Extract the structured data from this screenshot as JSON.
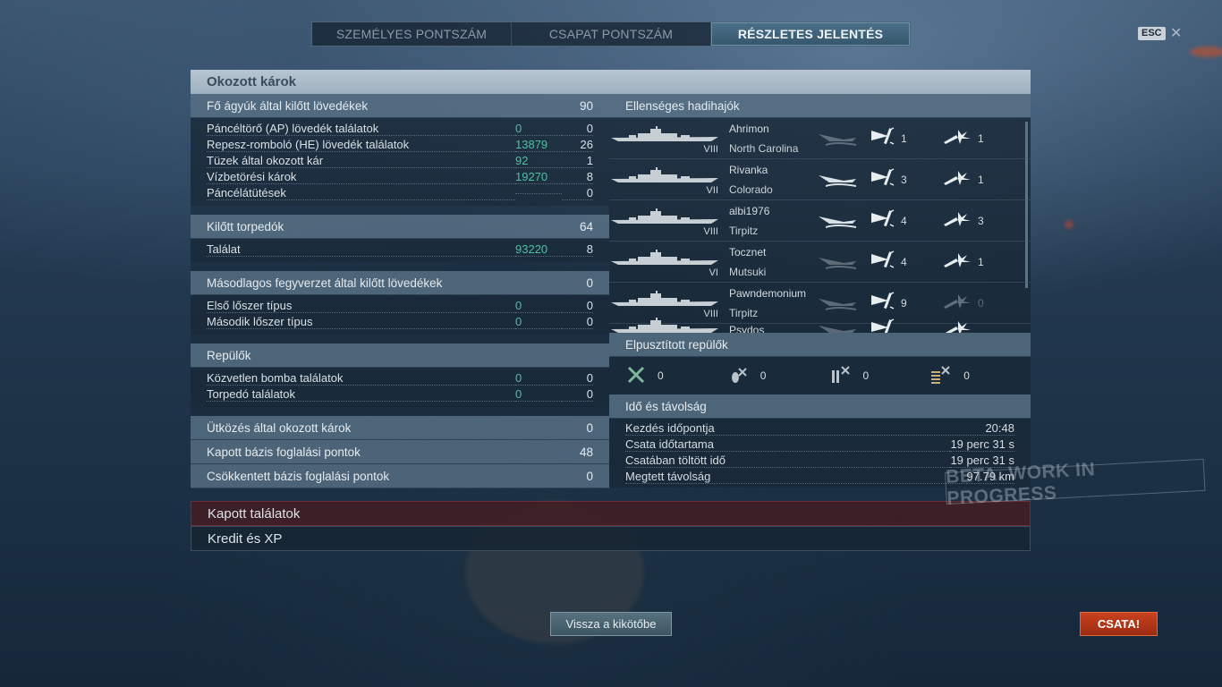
{
  "tabs": [
    {
      "label": "SZEMÉLYES PONTSZÁM"
    },
    {
      "label": "CSAPAT PONTSZÁM"
    },
    {
      "label": "RÉSZLETES JELENTÉS"
    }
  ],
  "esc_label": "ESC",
  "close_symbol": "✕",
  "panel_title": "Okozott károk",
  "main_guns": {
    "header": "Fő ágyúk által kilőtt lövedékek",
    "value": "90",
    "rows": [
      {
        "label": "Páncéltörő (AP) lövedék találatok",
        "dmg": "0",
        "count": "0"
      },
      {
        "label": "Repesz-romboló (HE) lövedék találatok",
        "dmg": "13879",
        "count": "26"
      },
      {
        "label": "Tüzek által okozott kár",
        "dmg": "92",
        "count": "1"
      },
      {
        "label": "Vízbetörési károk",
        "dmg": "19270",
        "count": "8"
      },
      {
        "label": "Páncélátütések",
        "dmg": "",
        "count": "0"
      }
    ]
  },
  "torpedoes": {
    "header": "Kilőtt torpedók",
    "value": "64",
    "rows": [
      {
        "label": "Találat",
        "dmg": "93220",
        "count": "8"
      }
    ]
  },
  "secondary": {
    "header": "Másodlagos fegyverzet által kilőtt lövedékek",
    "value": "0",
    "rows": [
      {
        "label": "Első lőszer típus",
        "dmg": "0",
        "count": "0"
      },
      {
        "label": "Második lőszer típus",
        "dmg": "0",
        "count": "0"
      }
    ]
  },
  "planes_section": {
    "header": "Repülők",
    "value": "",
    "rows": [
      {
        "label": "Közvetlen bomba találatok",
        "dmg": "0",
        "count": "0"
      },
      {
        "label": "Torpedó találatok",
        "dmg": "0",
        "count": "0"
      }
    ]
  },
  "ramming": {
    "label": "Ütközés által okozott károk",
    "value": "0"
  },
  "capture": {
    "label": "Kapott bázis foglalási pontok",
    "value": "48"
  },
  "defense": {
    "label": "Csökkentett bázis foglalási pontok",
    "value": "0"
  },
  "enemy_ships": {
    "header": "Ellenséges hadihajók",
    "ships": [
      {
        "player": "Ahrimon",
        "ship": "North Carolina",
        "tier": "VIII",
        "sunk": false,
        "shells": "1",
        "torps": "1"
      },
      {
        "player": "Rivanka",
        "ship": "Colorado",
        "tier": "VII",
        "sunk": true,
        "shells": "3",
        "torps": "1"
      },
      {
        "player": "albi1976",
        "ship": "Tirpitz",
        "tier": "VIII",
        "sunk": true,
        "shells": "4",
        "torps": "3"
      },
      {
        "player": "Tocznet",
        "ship": "Mutsuki",
        "tier": "VI",
        "sunk": false,
        "shells": "4",
        "torps": "1"
      },
      {
        "player": "Pawndemonium",
        "ship": "Tirpitz",
        "tier": "VIII",
        "sunk": false,
        "shells": "9",
        "torps": "0"
      },
      {
        "player": "Psydos",
        "ship": "",
        "tier": "",
        "sunk": false,
        "shells": "",
        "torps": ""
      }
    ]
  },
  "destroyed_planes": {
    "header": "Elpusztított repülők",
    "items": [
      {
        "icon": "fighter-icon",
        "value": "0"
      },
      {
        "icon": "bomber-icon",
        "value": "0"
      },
      {
        "icon": "torpedo-bomber-icon",
        "value": "0"
      },
      {
        "icon": "scout-plane-icon",
        "value": "0"
      }
    ]
  },
  "time_distance": {
    "header": "Idő és távolság",
    "rows": [
      {
        "label": "Kezdés időpontja",
        "value": "20:48"
      },
      {
        "label": "Csata időtartama",
        "value": "19 perc 31 s"
      },
      {
        "label": "Csatában töltött idő",
        "value": "19 perc 31 s"
      },
      {
        "label": "Megtett távolság",
        "value": "97.79 km"
      }
    ]
  },
  "received_hits": "Kapott találatok",
  "credits_xp": "Kredit és XP",
  "beta_watermark": "BETA. WORK IN PROGRESS",
  "back_button": "Vissza a kikötőbe",
  "battle_button": "CSATA!"
}
